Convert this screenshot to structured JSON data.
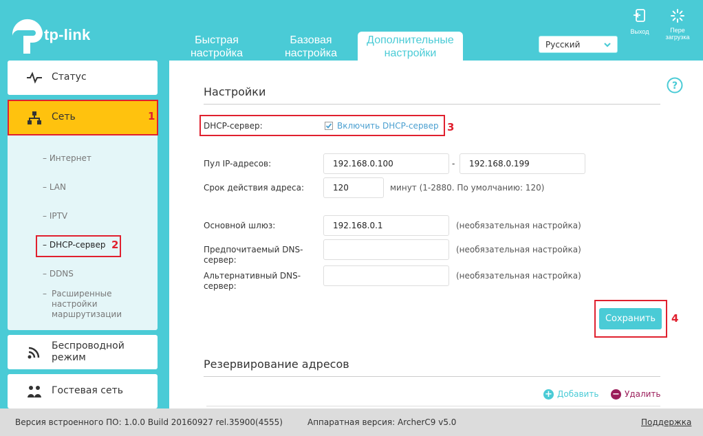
{
  "brand": {
    "logo_text": "tp-link"
  },
  "top_tabs": [
    {
      "label": "Быстрая настройка"
    },
    {
      "label": "Базовая настройка"
    },
    {
      "label": "Дополнительные настройки"
    }
  ],
  "language": {
    "selected": "Русский"
  },
  "header_buttons": {
    "logout": "Выход",
    "reboot": "Пере загрузка"
  },
  "sidebar": {
    "status": "Статус",
    "network": "Сеть",
    "sub_items": [
      "Интернет",
      "LAN",
      "IPTV",
      "DHCP-сервер",
      "DDNS",
      "Расширенные настройки маршрутизации"
    ],
    "wireless": "Беспроводной режим",
    "guest": "Гостевая сеть"
  },
  "annotations": {
    "n1": "1",
    "n2": "2",
    "n3": "3",
    "n4": "4"
  },
  "settings": {
    "title": "Настройки",
    "dhcp_label": "DHCP-сервер:",
    "dhcp_checkbox": "Включить DHCP-сервер",
    "pool_label": "Пул IP-адресов:",
    "pool_start": "192.168.0.100",
    "pool_sep": "-",
    "pool_end": "192.168.0.199",
    "lease_label": "Срок действия адреса:",
    "lease_value": "120",
    "lease_note": "минут (1-2880. По умолчанию: 120)",
    "gateway_label": "Основной шлюз:",
    "gateway_value": "192.168.0.1",
    "optional_note": "(необязательная настройка)",
    "dns1_label": "Предпочитаемый DNS-сервер:",
    "dns1_value": "",
    "dns2_label": "Альтернативный DNS-сервер:",
    "dns2_value": "",
    "save": "Сохранить"
  },
  "reservation": {
    "title": "Резервирование адресов",
    "add": "Добавить",
    "delete": "Удалить"
  },
  "footer": {
    "firmware": "Версия встроенного ПО: 1.0.0 Build 20160927 rel.35900(4555)",
    "hardware": "Аппаратная версия: ArcherC9 v5.0",
    "support": "Поддержка"
  },
  "colors": {
    "accent": "#4acbd6",
    "highlight": "#ffc20e",
    "annotation": "#e0202e",
    "link": "#4a9fd0"
  }
}
